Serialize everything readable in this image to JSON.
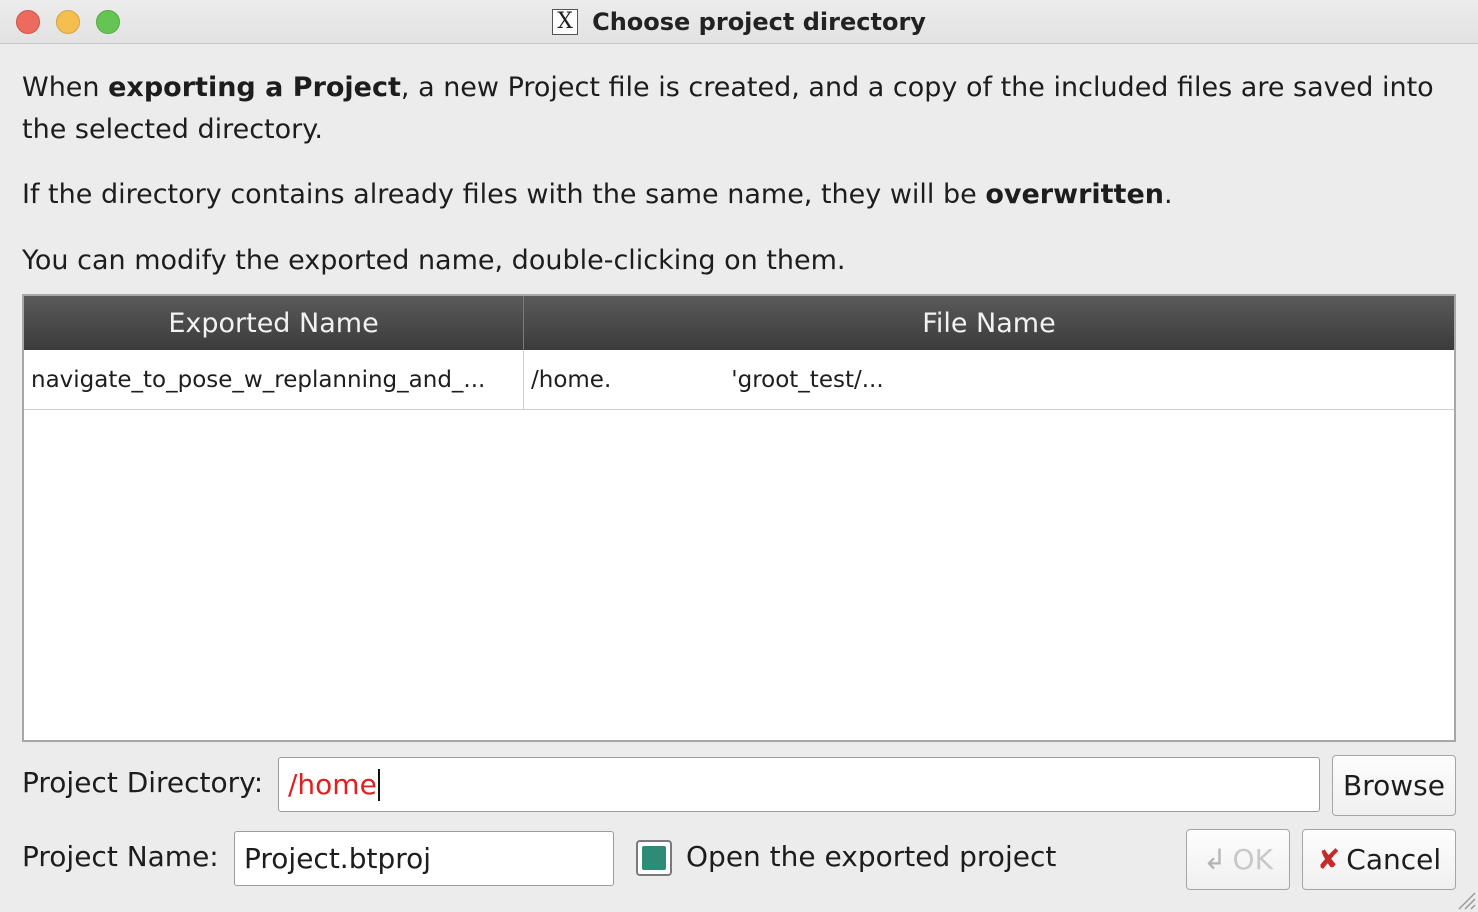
{
  "window": {
    "title": "Choose project directory",
    "title_icon_glyph": "X"
  },
  "intro": {
    "p1_pre": "When ",
    "p1_bold": "exporting a Project",
    "p1_post": ", a new Project file is created, and a copy of the included files are saved into the selected directory.",
    "p2_pre": "If the directory contains already files with the same name, they will be ",
    "p2_bold": "overwritten",
    "p2_post": ".",
    "p3": "You can modify the exported name, double-clicking on them."
  },
  "table": {
    "columns": [
      "Exported Name",
      "File Name"
    ],
    "rows": [
      {
        "exported_name": "navigate_to_pose_w_replanning_and_...",
        "file_name_start": "/home.",
        "file_name_end": "'groot_test/..."
      }
    ]
  },
  "form": {
    "directory_label": "Project Directory:",
    "directory_value": "/home",
    "browse_label": "Browse",
    "name_label": "Project Name:",
    "name_value": "Project.btproj",
    "open_checkbox_label": "Open the exported project",
    "open_checkbox_checked": true,
    "ok_label": "OK",
    "cancel_label": "Cancel"
  },
  "colors": {
    "invalid_path": "#e02020",
    "checkbox_fill": "#2e8b75",
    "cancel_icon": "#c42b2b"
  }
}
